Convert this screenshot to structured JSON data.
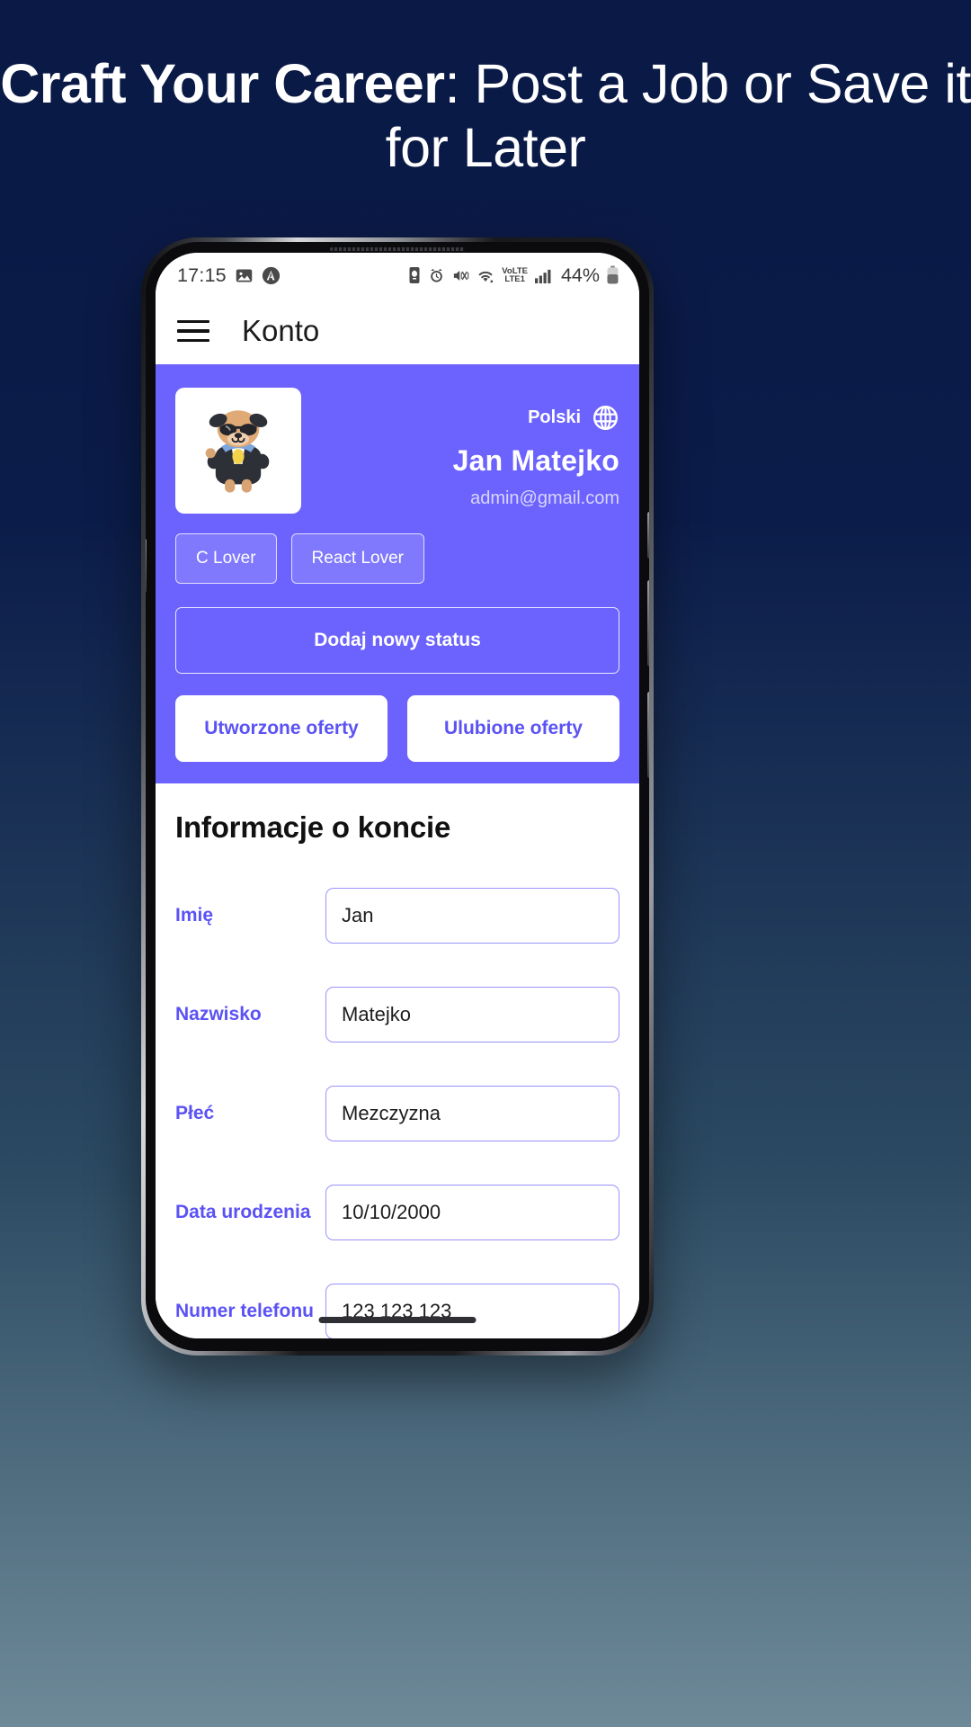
{
  "headline": {
    "bold_part": "Craft Your Career",
    "rest_part": ": Post a Job or Save it for Later"
  },
  "phone": {
    "statusbar": {
      "time": "17:15",
      "icons_left": [
        "image-icon",
        "app-circle-icon"
      ],
      "icons_right": [
        "battery-saver-icon",
        "alarm-icon",
        "mute-vibrate-icon",
        "wifi-icon"
      ],
      "network_label_top": "VoLTE",
      "network_label_bottom": "LTE1",
      "signal": "signal-bars-icon",
      "battery_percent": "44%"
    },
    "appbar": {
      "menu_icon": "hamburger-menu-icon",
      "title": "Konto"
    },
    "profile": {
      "avatar_alt": "dog-in-suit-avatar",
      "language": "Polski",
      "language_icon": "globe-icon",
      "name": "Jan Matejko",
      "email": "admin@gmail.com",
      "tags": [
        "C Lover",
        "React Lover"
      ],
      "add_status_label": "Dodaj nowy status",
      "created_offers_label": "Utworzone oferty",
      "favourite_offers_label": "Ulubione oferty"
    },
    "account": {
      "title": "Informacje o koncie",
      "fields": [
        {
          "label": "Imię",
          "value": "Jan"
        },
        {
          "label": "Nazwisko",
          "value": "Matejko"
        },
        {
          "label": "Płeć",
          "value": "Mezczyzna"
        },
        {
          "label": "Data urodzenia",
          "value": "10/10/2000"
        },
        {
          "label": "Numer telefonu",
          "value": "123 123 123"
        }
      ]
    }
  },
  "colors": {
    "background_top": "#0a1945",
    "background_bottom": "#6e8a99",
    "accent_purple": "#6c63fe",
    "accent_text": "#5b52f5"
  }
}
